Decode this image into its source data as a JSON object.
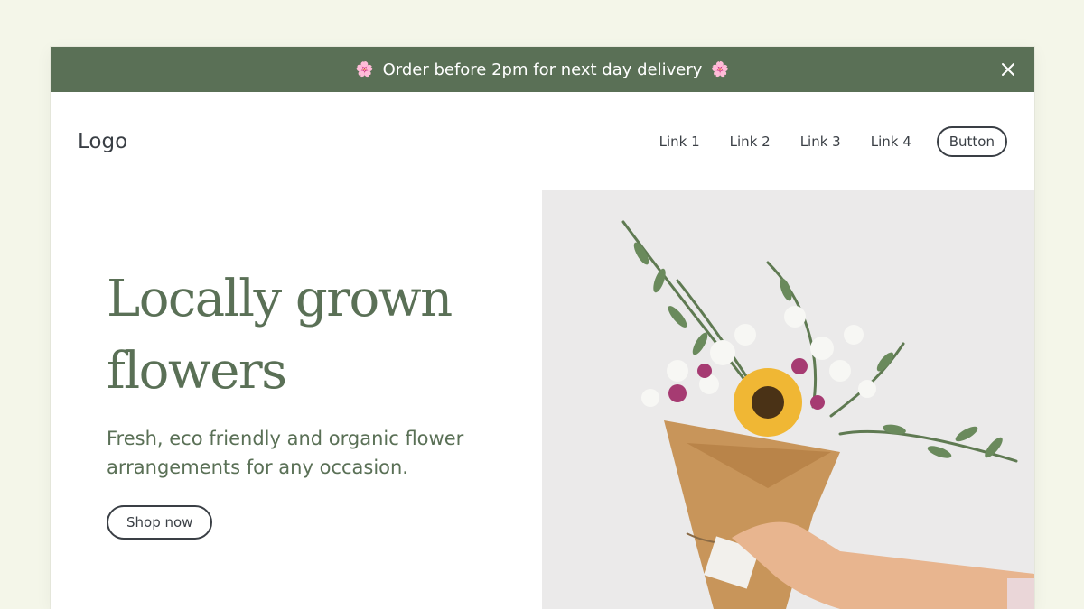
{
  "banner": {
    "emoji_left": "🌸",
    "text": "Order before 2pm for next day delivery",
    "emoji_right": "🌸",
    "close_icon": "close-icon",
    "background": "#5a7056"
  },
  "nav": {
    "logo": "Logo",
    "links": [
      "Link 1",
      "Link 2",
      "Link 3",
      "Link 4"
    ],
    "button_label": "Button"
  },
  "hero": {
    "headline_line1": "Locally grown",
    "headline_line2": "flowers",
    "subtext": "Fresh, eco friendly and organic flower arrangements for any occasion.",
    "cta_label": "Shop now",
    "accent_color": "#5a7056"
  },
  "image": {
    "subject": "bouquet-photo"
  }
}
